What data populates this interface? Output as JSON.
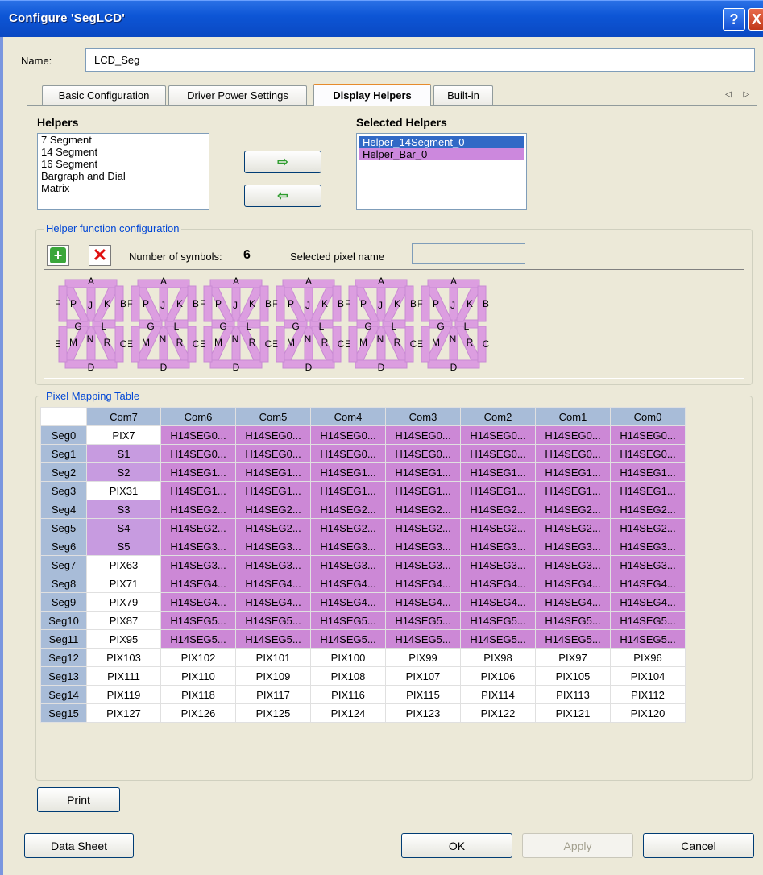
{
  "window": {
    "title": "Configure 'SegLCD'",
    "help_label": "?",
    "close_label": "X"
  },
  "name_field": {
    "label": "Name:",
    "value": "LCD_Seg"
  },
  "tabs": [
    {
      "label": "Basic Configuration",
      "active": false
    },
    {
      "label": "Driver Power Settings",
      "active": false
    },
    {
      "label": "Display Helpers",
      "active": true
    },
    {
      "label": "Built-in",
      "active": false
    }
  ],
  "tab_scroll": "◁ ▷",
  "helpers": {
    "title": "Helpers",
    "items": [
      "7 Segment",
      "14 Segment",
      "16 Segment",
      "Bargraph and Dial",
      "Matrix"
    ]
  },
  "move_buttons": {
    "add_glyph": "⇨",
    "remove_glyph": "⇦"
  },
  "selected_helpers": {
    "title": "Selected Helpers",
    "items": [
      "Helper_14Segment_0",
      "Helper_Bar_0"
    ]
  },
  "helper_config": {
    "group_label": "Helper function configuration",
    "add_icon": "plus-icon",
    "delete_icon": "delete-x-icon",
    "num_symbols_label": "Number of symbols:",
    "num_symbols_value": "6",
    "selected_pixel_label": "Selected pixel name",
    "selected_pixel_value": "",
    "symbol_letters": {
      "A": "A",
      "B": "B",
      "C": "C",
      "D": "D",
      "E": "E",
      "F": "F",
      "G": "G",
      "J": "J",
      "K": "K",
      "L": "L",
      "M": "M",
      "N": "N",
      "P": "P",
      "R": "R"
    },
    "colors": {
      "segment": "#dc9ee0",
      "segment_edge": "#c98ad3"
    }
  },
  "pixel_mapping": {
    "group_label": "Pixel Mapping Table",
    "columns": [
      "Com7",
      "Com6",
      "Com5",
      "Com4",
      "Com3",
      "Com2",
      "Com1",
      "Com0"
    ],
    "rows": [
      {
        "seg": "Seg0",
        "cells": [
          "PIX7",
          "H14SEG0...",
          "H14SEG0...",
          "H14SEG0...",
          "H14SEG0...",
          "H14SEG0...",
          "H14SEG0...",
          "H14SEG0..."
        ]
      },
      {
        "seg": "Seg1",
        "cells": [
          "S1",
          "H14SEG0...",
          "H14SEG0...",
          "H14SEG0...",
          "H14SEG0...",
          "H14SEG0...",
          "H14SEG0...",
          "H14SEG0..."
        ]
      },
      {
        "seg": "Seg2",
        "cells": [
          "S2",
          "H14SEG1...",
          "H14SEG1...",
          "H14SEG1...",
          "H14SEG1...",
          "H14SEG1...",
          "H14SEG1...",
          "H14SEG1..."
        ]
      },
      {
        "seg": "Seg3",
        "cells": [
          "PIX31",
          "H14SEG1...",
          "H14SEG1...",
          "H14SEG1...",
          "H14SEG1...",
          "H14SEG1...",
          "H14SEG1...",
          "H14SEG1..."
        ]
      },
      {
        "seg": "Seg4",
        "cells": [
          "S3",
          "H14SEG2...",
          "H14SEG2...",
          "H14SEG2...",
          "H14SEG2...",
          "H14SEG2...",
          "H14SEG2...",
          "H14SEG2..."
        ]
      },
      {
        "seg": "Seg5",
        "cells": [
          "S4",
          "H14SEG2...",
          "H14SEG2...",
          "H14SEG2...",
          "H14SEG2...",
          "H14SEG2...",
          "H14SEG2...",
          "H14SEG2..."
        ]
      },
      {
        "seg": "Seg6",
        "cells": [
          "S5",
          "H14SEG3...",
          "H14SEG3...",
          "H14SEG3...",
          "H14SEG3...",
          "H14SEG3...",
          "H14SEG3...",
          "H14SEG3..."
        ]
      },
      {
        "seg": "Seg7",
        "cells": [
          "PIX63",
          "H14SEG3...",
          "H14SEG3...",
          "H14SEG3...",
          "H14SEG3...",
          "H14SEG3...",
          "H14SEG3...",
          "H14SEG3..."
        ]
      },
      {
        "seg": "Seg8",
        "cells": [
          "PIX71",
          "H14SEG4...",
          "H14SEG4...",
          "H14SEG4...",
          "H14SEG4...",
          "H14SEG4...",
          "H14SEG4...",
          "H14SEG4..."
        ]
      },
      {
        "seg": "Seg9",
        "cells": [
          "PIX79",
          "H14SEG4...",
          "H14SEG4...",
          "H14SEG4...",
          "H14SEG4...",
          "H14SEG4...",
          "H14SEG4...",
          "H14SEG4..."
        ]
      },
      {
        "seg": "Seg10",
        "cells": [
          "PIX87",
          "H14SEG5...",
          "H14SEG5...",
          "H14SEG5...",
          "H14SEG5...",
          "H14SEG5...",
          "H14SEG5...",
          "H14SEG5..."
        ]
      },
      {
        "seg": "Seg11",
        "cells": [
          "PIX95",
          "H14SEG5...",
          "H14SEG5...",
          "H14SEG5...",
          "H14SEG5...",
          "H14SEG5...",
          "H14SEG5...",
          "H14SEG5..."
        ]
      },
      {
        "seg": "Seg12",
        "cells": [
          "PIX103",
          "PIX102",
          "PIX101",
          "PIX100",
          "PIX99",
          "PIX98",
          "PIX97",
          "PIX96"
        ]
      },
      {
        "seg": "Seg13",
        "cells": [
          "PIX111",
          "PIX110",
          "PIX109",
          "PIX108",
          "PIX107",
          "PIX106",
          "PIX105",
          "PIX104"
        ]
      },
      {
        "seg": "Seg14",
        "cells": [
          "PIX119",
          "PIX118",
          "PIX117",
          "PIX116",
          "PIX115",
          "PIX114",
          "PIX113",
          "PIX112"
        ]
      },
      {
        "seg": "Seg15",
        "cells": [
          "PIX127",
          "PIX126",
          "PIX125",
          "PIX124",
          "PIX123",
          "PIX122",
          "PIX121",
          "PIX120"
        ]
      }
    ],
    "colors": {
      "header": "#a8bcd8",
      "helper_pixel": "#cc88d6",
      "bar_pixel": "#c79be0",
      "unused": "#ffffff"
    }
  },
  "buttons": {
    "print": "Print",
    "data_sheet": "Data Sheet",
    "ok": "OK",
    "apply": "Apply",
    "cancel": "Cancel"
  }
}
